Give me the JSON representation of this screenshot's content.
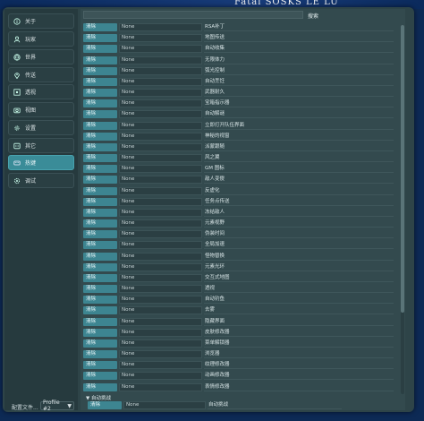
{
  "background_banner": "Fatal SOSKS LE LU",
  "sidebar": {
    "items": [
      {
        "label": "关于",
        "icon": "info-icon"
      },
      {
        "label": "玩家",
        "icon": "user-icon"
      },
      {
        "label": "世界",
        "icon": "globe-icon"
      },
      {
        "label": "传送",
        "icon": "location-icon"
      },
      {
        "label": "透视",
        "icon": "eye-icon"
      },
      {
        "label": "视图",
        "icon": "camera-icon"
      },
      {
        "label": "设置",
        "icon": "gear-icon"
      },
      {
        "label": "其它",
        "icon": "more-icon"
      },
      {
        "label": "热键",
        "icon": "keyboard-icon"
      },
      {
        "label": "调试",
        "icon": "debug-icon"
      }
    ],
    "active_item": "热键",
    "config_label": "配置文件...",
    "profile_value": "Profile #2"
  },
  "search": {
    "button_label": "搜索",
    "value": ""
  },
  "hotkeys": {
    "clear_label": "清除",
    "rows": [
      {
        "key": "None",
        "label": "RSA补丁"
      },
      {
        "key": "None",
        "label": "地图传送"
      },
      {
        "key": "None",
        "label": "自动收集"
      },
      {
        "key": "None",
        "label": "无限体力"
      },
      {
        "key": "None",
        "label": "弧光控制"
      },
      {
        "key": "None",
        "label": "自动烹饪"
      },
      {
        "key": "None",
        "label": "武器耐久"
      },
      {
        "key": "None",
        "label": "宝箱指示器"
      },
      {
        "key": "None",
        "label": "自动解谜"
      },
      {
        "key": "None",
        "label": "立即打开队伍界面"
      },
      {
        "key": "None",
        "label": "神秘的视窗"
      },
      {
        "key": "None",
        "label": "派蒙跟随"
      },
      {
        "key": "None",
        "label": "风之翼"
      },
      {
        "key": "None",
        "label": "GM 图标"
      },
      {
        "key": "None",
        "label": "敌人变傻"
      },
      {
        "key": "None",
        "label": "反虚化"
      },
      {
        "key": "None",
        "label": "任务点传送"
      },
      {
        "key": "None",
        "label": "冻结敌人"
      },
      {
        "key": "None",
        "label": "元素视野"
      },
      {
        "key": "None",
        "label": "伪装时间"
      },
      {
        "key": "None",
        "label": "全局加速"
      },
      {
        "key": "None",
        "label": "怪物替换"
      },
      {
        "key": "None",
        "label": "元素光环"
      },
      {
        "key": "None",
        "label": "交互式地图"
      },
      {
        "key": "None",
        "label": "透视"
      },
      {
        "key": "None",
        "label": "自动钓鱼"
      },
      {
        "key": "None",
        "label": "去雾"
      },
      {
        "key": "None",
        "label": "隐藏界面"
      },
      {
        "key": "None",
        "label": "皮肤修改器"
      },
      {
        "key": "None",
        "label": "菜单解锁器"
      },
      {
        "key": "None",
        "label": "浏览器"
      },
      {
        "key": "None",
        "label": "纹理修改器"
      },
      {
        "key": "None",
        "label": "动画修改器"
      },
      {
        "key": "None",
        "label": "表情修改器"
      }
    ]
  },
  "auto_section": {
    "header": "▼ 自动挑战",
    "row": {
      "clear": "清除",
      "key": "None",
      "label": "自动挑战"
    }
  }
}
